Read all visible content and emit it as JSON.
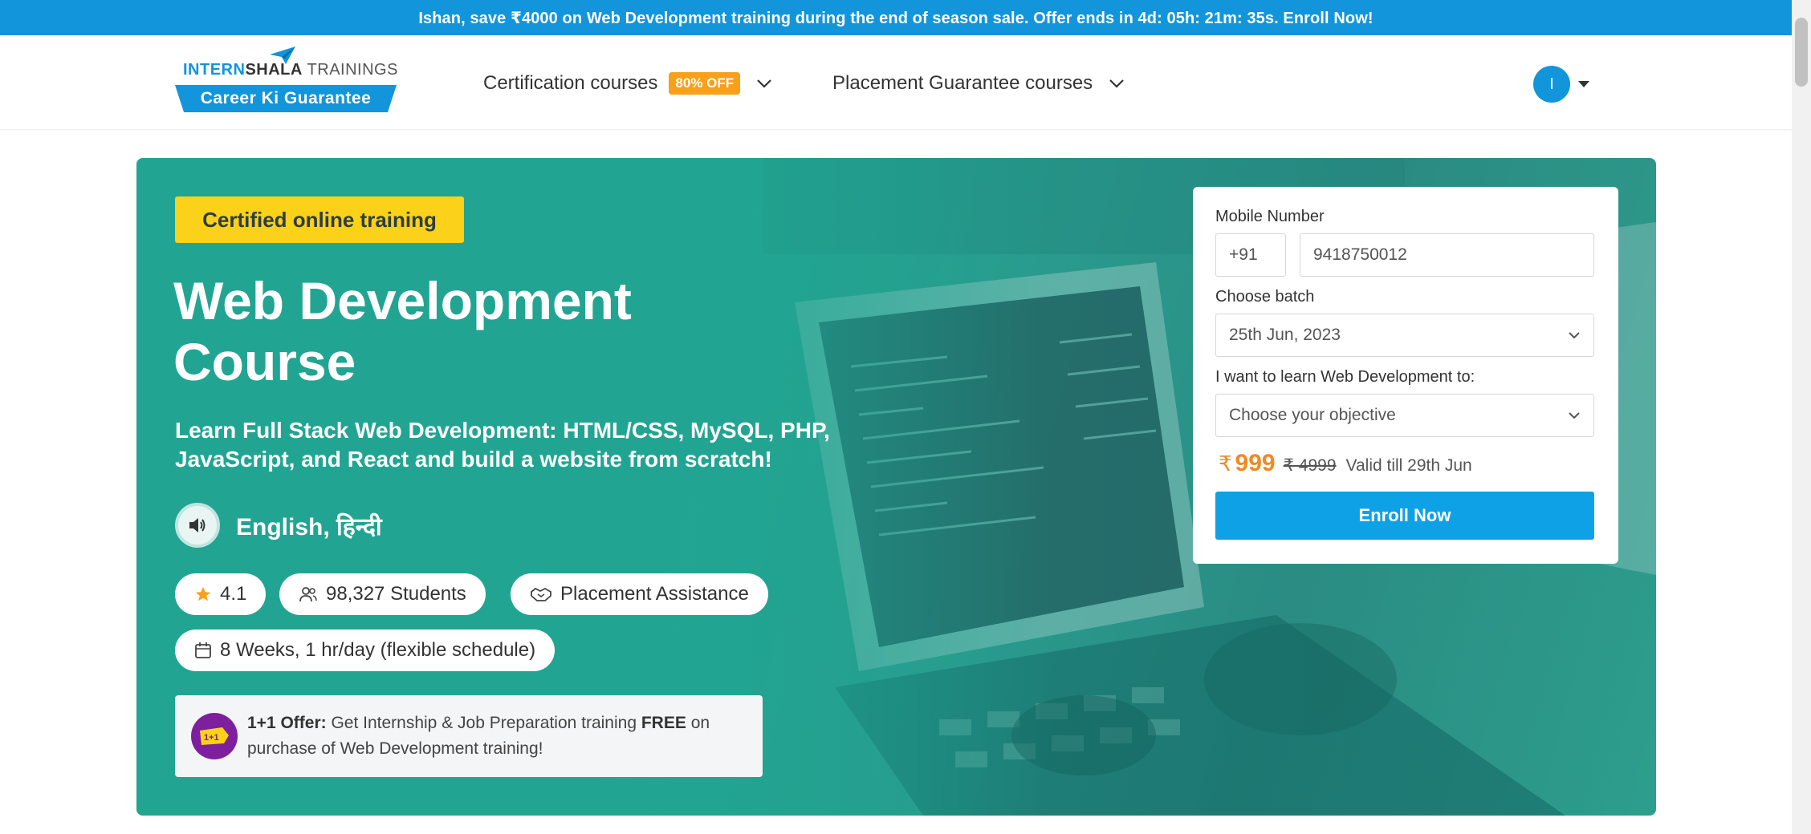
{
  "promo": {
    "text": "Ishan, save ₹4000 on Web Development training during the end of season sale. Offer ends in 4d: 05h: 21m: 35s. Enroll Now!"
  },
  "header": {
    "logo": {
      "brand_a": "INTERN",
      "brand_b": "SHALA",
      "brand_c": " TRAININGS",
      "tagline": "Career Ki Guarantee"
    },
    "nav": {
      "certification_label": "Certification courses",
      "certification_badge": "80% OFF",
      "placement_label": "Placement Guarantee courses"
    },
    "user": {
      "avatar_initial": "I"
    }
  },
  "hero": {
    "badge": "Certified online training",
    "title_line1": "Web Development",
    "title_line2": "Course",
    "subtitle": "Learn Full Stack Web Development: HTML/CSS, MySQL, PHP, JavaScript, and React and build a website from scratch!",
    "languages": "English, हिन्दी",
    "rating": "4.1",
    "students": "98,327 Students",
    "placement": "Placement Assistance",
    "duration": "8 Weeks, 1 hr/day (flexible schedule)",
    "offer": {
      "lead": "1+1 Offer:",
      "text_a": " Get Internship & Job Preparation training ",
      "free": "FREE",
      "text_b": " on purchase of Web Development training!",
      "icon_label": "1+1"
    }
  },
  "form": {
    "mobile_label": "Mobile Number",
    "country_code": "+91",
    "mobile_value": "9418750012",
    "batch_label": "Choose batch",
    "batch_value": "25th Jun, 2023",
    "objective_label": "I want to learn Web Development to:",
    "objective_placeholder": "Choose your objective",
    "currency": "₹",
    "price_now": "999",
    "price_old": "₹ 4999",
    "valid_till": "Valid till 29th Jun",
    "enroll_label": "Enroll Now"
  },
  "colors": {
    "brand_blue": "#1295db",
    "hero_teal": "#21a592",
    "badge_yellow": "#fcd119",
    "offer_orange": "#f8a01a",
    "enroll_blue": "#0ea1e6"
  }
}
